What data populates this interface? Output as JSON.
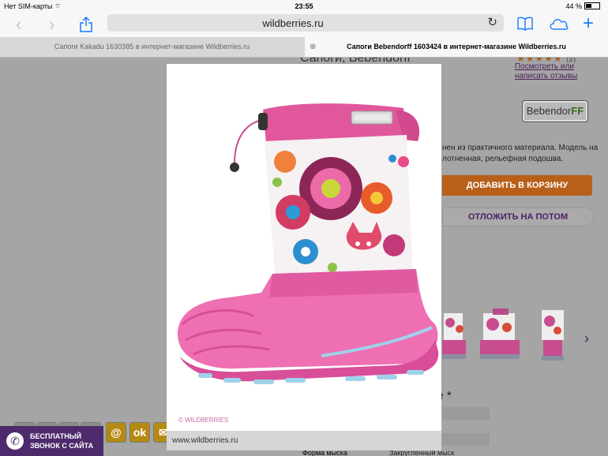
{
  "status_bar": {
    "carrier": "Нет SIM-карты",
    "time": "23:55",
    "battery": "44 %"
  },
  "browser": {
    "url": "wildberries.ru"
  },
  "tabs": [
    {
      "title": "Сапоги Kakadu 1630385 в интернет-магазине Wildberries.ru"
    },
    {
      "title": "Сапоги Bebendorff 1603424 в интернет-магазине Wildberries.ru"
    }
  ],
  "page": {
    "title": "Сапоги, Bebendorff",
    "review_link": "Посмотреть или\nнаписать отзывы",
    "brand": {
      "name_a": "Bebendor",
      "name_b": "FF"
    },
    "description": "нен из практичного материала. Модель на\nлотненная, рельефная подошва.",
    "add_to_cart": "ДОБАВИТЬ В КОРЗИНУ",
    "save_later": "ОТЛОЖИТЬ НА ПОТОМ",
    "subhead": "ие *",
    "spec_label": "Форма мыска",
    "spec_value": "Закругленный мыск",
    "callback": "БЕСПЛАТНЫЙ\nЗВОНОК С САЙТА"
  },
  "modal": {
    "watermark": "© WILDBERRIES",
    "url": "www.wildberries.ru"
  },
  "colors": {
    "accent": "#1a7aff",
    "brand_purple": "#4c2a6b",
    "cart_orange": "#b8601a",
    "boot_pink": "#e95aa4"
  }
}
